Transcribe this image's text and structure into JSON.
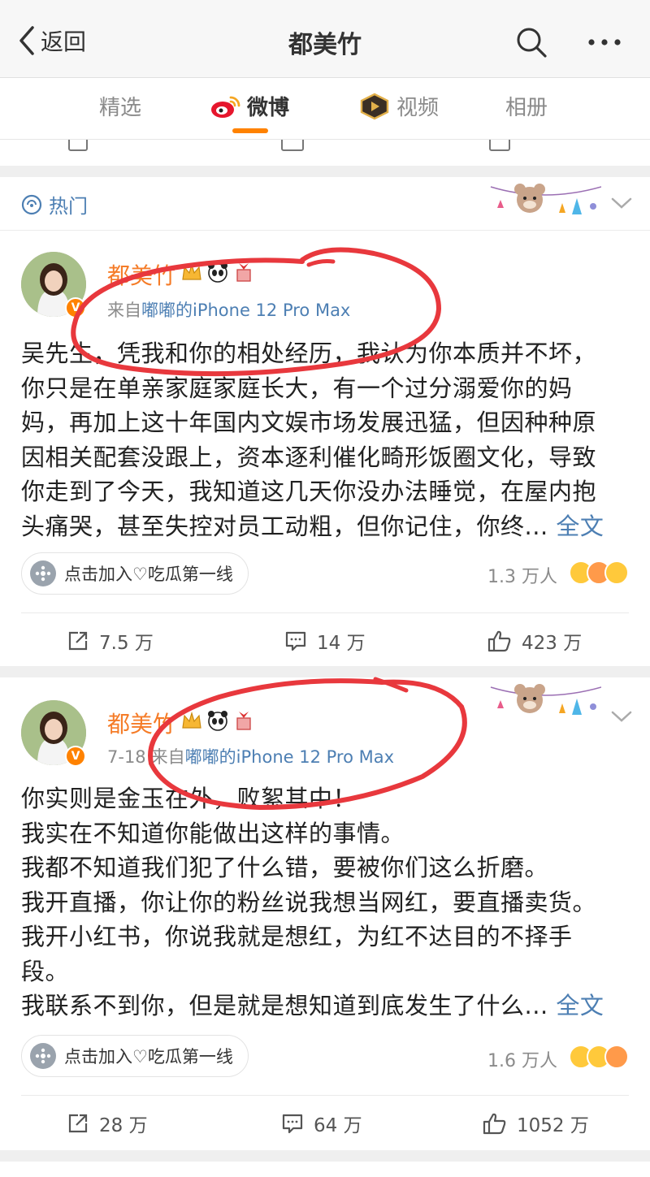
{
  "navbar": {
    "back_label": "返回",
    "title": "都美竹"
  },
  "tabs": [
    {
      "label": "精选",
      "active": false
    },
    {
      "label": "微博",
      "active": true
    },
    {
      "label": "视频",
      "active": false
    },
    {
      "label": "相册",
      "active": false
    }
  ],
  "hot_section": {
    "label": "热门"
  },
  "posts": [
    {
      "author": "都美竹",
      "time": "",
      "source_prefix": "来自",
      "source_device": "嘟嘟的iPhone 12 Pro Max",
      "lines": [
        "吴先生，凭我和你的相处经历，我认为你本质并不坏，",
        "你只是在单亲家庭家庭长大，有一个过分溺爱你的妈",
        "妈，再加上这十年国内文娱市场发展迅猛，但因种种原",
        "因相关配套没跟上，资本逐利催化畸形饭圈文化，导致",
        "你走到了今天，我知道这几天你没办法睡觉，在屋内抱",
        "头痛哭，甚至失控对员工动粗，但你记住，你终... "
      ],
      "full_text_label": "全文",
      "group_label": "点击加入♡吃瓜第一线",
      "people_count": "1.3 万人",
      "repost": "7.5 万",
      "comment": "14 万",
      "like": "423 万"
    },
    {
      "author": "都美竹",
      "time": "7-18",
      "source_prefix": "来自",
      "source_device": "嘟嘟的iPhone 12 Pro Max",
      "lines": [
        "你实则是金玉在外，败絮其中！",
        "我实在不知道你能做出这样的事情。",
        "我都不知道我们犯了什么错，要被你们这么折磨。",
        "我开直播，你让你的粉丝说我想当网红，要直播卖货。",
        "我开小红书，你说我就是想红，为红不达目的不择手",
        "段。",
        "我联系不到你，但是就是想知道到底发生了什么... "
      ],
      "full_text_label": "全文",
      "group_label": "点击加入♡吃瓜第一线",
      "people_count": "1.6 万人",
      "repost": "28 万",
      "comment": "64 万",
      "like": "1052 万"
    }
  ],
  "colors": {
    "accent": "#ff8200",
    "link": "#4d7fb3",
    "name": "#f57c28",
    "annotation": "#e8383d"
  }
}
